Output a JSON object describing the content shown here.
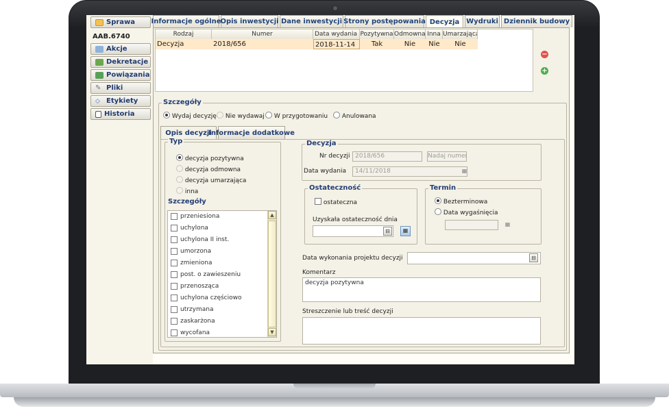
{
  "sidebar": {
    "sprawa_label": "Sprawa",
    "case_number": "AAB.6740",
    "items": [
      {
        "label": "Akcje",
        "icon": "actions-icon"
      },
      {
        "label": "Dekretacje",
        "icon": "people-icon"
      },
      {
        "label": "Powiązania",
        "icon": "links-icon"
      },
      {
        "label": "Pliki",
        "icon": "paperclip-icon"
      },
      {
        "label": "Etykiety",
        "icon": "tag-icon"
      },
      {
        "label": "Historia",
        "icon": "document-icon"
      }
    ]
  },
  "top_tabs": [
    "Informacje ogólne",
    "Opis inwestycji",
    "Dane inwestycji",
    "Strony postępowania",
    "Decyzja",
    "Wydruki",
    "Dziennik budowy"
  ],
  "active_top_tab": "Decyzja",
  "grid": {
    "headers": [
      "Rodzaj",
      "Numer",
      "Data wydania",
      "Pozytywna",
      "Odmowna",
      "Inna",
      "Umarzająca"
    ],
    "rows": [
      [
        "Decyzja",
        "2018/656",
        "2018-11-14",
        "Tak",
        "Nie",
        "Nie",
        "Nie"
      ]
    ]
  },
  "szczegoly": {
    "title": "Szczegóły",
    "options": [
      {
        "label": "Wydaj decyzję",
        "selected": true,
        "disabled": false
      },
      {
        "label": "Nie wydawaj",
        "selected": false,
        "disabled": true
      },
      {
        "label": "W przygotowaniu",
        "selected": false,
        "disabled": false
      },
      {
        "label": "Anulowana",
        "selected": false,
        "disabled": false
      }
    ]
  },
  "inner_tabs": [
    "Opis decyzji",
    "Informacje dodatkowe"
  ],
  "typ": {
    "title": "Typ",
    "options": [
      {
        "label": "decyzja pozytywna",
        "selected": true,
        "disabled": false
      },
      {
        "label": "decyzja odmowna",
        "selected": false,
        "disabled": true
      },
      {
        "label": "decyzja umarzająca",
        "selected": false,
        "disabled": true
      },
      {
        "label": "inna",
        "selected": false,
        "disabled": true
      }
    ]
  },
  "details_list": {
    "title": "Szczegóły",
    "items": [
      "przeniesiona",
      "uchylona",
      "uchylona II inst.",
      "umorzona",
      "zmieniona",
      "post. o zawieszeniu",
      "przenosząca",
      "uchylona częściowo",
      "utrzymana",
      "zaskarżona",
      "wycofana"
    ]
  },
  "decyzja": {
    "title": "Decyzja",
    "nr_label": "Nr decyzji",
    "nr_value": "2018/656",
    "nadaj_label": "Nadaj numer",
    "data_label": "Data wydania",
    "data_value": "14/11/2018"
  },
  "ostatecznosc": {
    "title": "Ostateczność",
    "checkbox_label": "ostateczna",
    "date_label": "Uzyskała ostateczność dnia",
    "date_value": ""
  },
  "termin": {
    "title": "Termin",
    "opt1": "Bezterminowa",
    "opt2": "Data wygaśnięcia"
  },
  "fields": {
    "projekt_label": "Data wykonania projektu decyzji",
    "projekt_value": "",
    "komentarz_label": "Komentarz",
    "komentarz_value": "decyzja pozytywna",
    "streszczenie_label": "Streszczenie lub treść decyzji",
    "streszczenie_value": ""
  },
  "colors": {
    "selected_row": "#ffe9c9",
    "tab_text": "#20447a",
    "remove_icon": "#e0524f",
    "add_icon": "#4cae4c"
  }
}
